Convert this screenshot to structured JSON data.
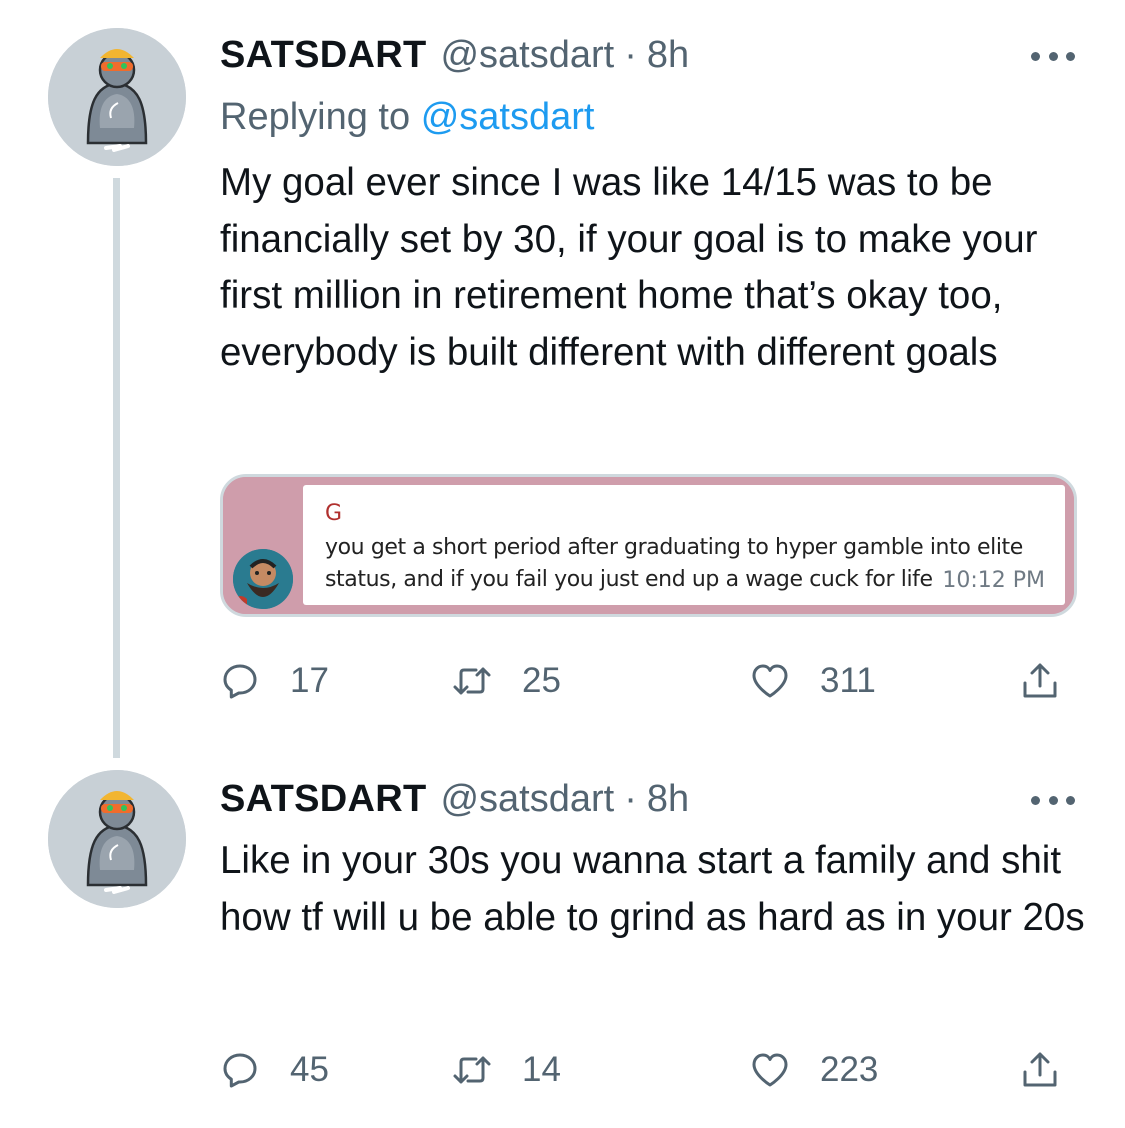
{
  "tweets": [
    {
      "name": "SATSDART",
      "handle": "@satsdart",
      "separator": "·",
      "time": "8h",
      "replying_prefix": "Replying to",
      "replying_handle": "@satsdart",
      "text": "My goal ever since I was like 14/15 was to be financially set by 30, if your goal is to make your first million in retirement home that’s okay too, everybody is built different with different goals",
      "embed": {
        "sender": "G",
        "message": "you get a short period after graduating to hyper gamble into elite status, and if you fail you just end up a wage cuck for life",
        "time": "10:12 PM",
        "colors": {
          "background": "#cf9dab",
          "sender": "#b0302e"
        }
      },
      "replies": "17",
      "retweets": "25",
      "likes": "311"
    },
    {
      "name": "SATSDART",
      "handle": "@satsdart",
      "separator": "·",
      "time": "8h",
      "text": "Like in your 30s you wanna start a family and shit how tf will u be able to grind as hard as in your 20s",
      "replies": "45",
      "retweets": "14",
      "likes": "223"
    }
  ],
  "icons": {
    "reply": "reply-icon",
    "retweet": "retweet-icon",
    "like": "heart-icon",
    "share": "share-icon",
    "more": "more-icon"
  },
  "colors": {
    "text": "#0f1419",
    "secondary": "#536471",
    "link": "#1d9bf0",
    "thread_line": "#cfd9de"
  }
}
